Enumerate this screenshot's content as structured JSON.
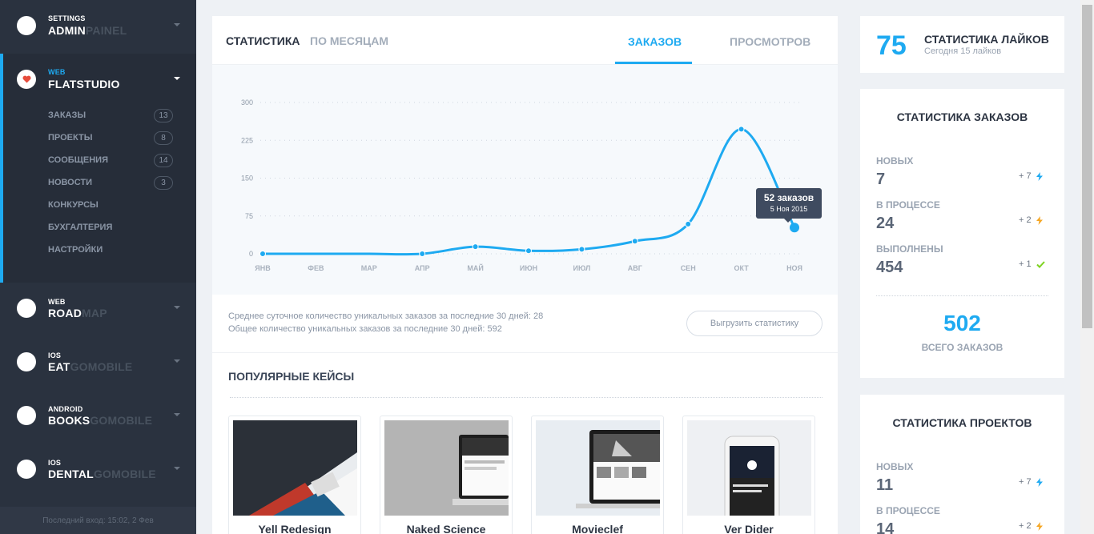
{
  "sidebar": {
    "projects": [
      {
        "prefix": "SETTINGS",
        "name_bold": "ADMIN",
        "name_dim": "PAINEL",
        "icon": "white-circle"
      },
      {
        "prefix": "WEB",
        "name_bold": "FLATSTUDIO",
        "name_dim": "",
        "icon": "heart-icon",
        "active": true
      },
      {
        "prefix": "WEB",
        "name_bold": "ROAD",
        "name_dim": "MAP",
        "icon": "white-circle"
      },
      {
        "prefix": "IOS",
        "name_bold": "EAT",
        "name_dim": "GOMOBILE",
        "icon": "white-circle"
      },
      {
        "prefix": "ANDROID",
        "name_bold": "BOOKS",
        "name_dim": "GOMOBILE",
        "icon": "white-circle"
      },
      {
        "prefix": "IOS",
        "name_bold": "DENTAL",
        "name_dim": "GOMOBILE",
        "icon": "white-circle"
      }
    ],
    "submenu": [
      {
        "label": "ЗАКАЗЫ",
        "count": "13"
      },
      {
        "label": "ПРОЕКТЫ",
        "count": "8"
      },
      {
        "label": "СООБЩЕНИЯ",
        "count": "14"
      },
      {
        "label": "НОВОСТИ",
        "count": "3"
      },
      {
        "label": "КОНКУРСЫ",
        "count": ""
      },
      {
        "label": "БУХГАЛТЕРИЯ",
        "count": ""
      },
      {
        "label": "НАСТРОЙКИ",
        "count": ""
      }
    ],
    "last_login": "Последний вход: 15:02, 2 Фев"
  },
  "main": {
    "tabs_left": [
      "СТАТИСТИКА",
      "ПО МЕСЯЦАМ"
    ],
    "tabs_right": [
      "ЗАКАЗОВ",
      "ПРОСМОТРОВ"
    ],
    "active_right_tab": "ЗАКАЗОВ",
    "tooltip": {
      "title": "52 заказов",
      "date": "5 Ноя 2015"
    },
    "info_line1": "Среднее суточное количество уникальных заказов за последние 30 дней: 28",
    "info_line2": "Общее количество уникальных заказов за последние 30 дней: 592",
    "export_button": "Выгрузить статистику",
    "popular_title": "ПОПУЛЯРНЫЕ КЕЙСЫ",
    "cases": [
      {
        "title": "Yell Redesign"
      },
      {
        "title": "Naked Science"
      },
      {
        "title": "Movieclef"
      },
      {
        "title": "Ver Dider"
      }
    ]
  },
  "chart_data": {
    "type": "line",
    "categories": [
      "ЯНВ",
      "ФЕВ",
      "МАР",
      "АПР",
      "МАЙ",
      "ИЮН",
      "ИЮЛ",
      "АВГ",
      "СЕН",
      "ОКТ",
      "НОЯ"
    ],
    "values": [
      0,
      0,
      0,
      0,
      14,
      6,
      9,
      25,
      59,
      247,
      52
    ],
    "yticks": [
      0,
      75,
      150,
      225,
      300
    ],
    "ylim": [
      0,
      300
    ],
    "grid": true,
    "color": "#1eaaf1"
  },
  "likes": {
    "value": "75",
    "title": "СТАТИСТИКА ЛАЙКОВ",
    "sub": "Сегодня 15 лайков"
  },
  "orders_stats": {
    "title": "СТАТИСТИКА ЗАКАЗОВ",
    "rows": [
      {
        "label": "НОВЫХ",
        "value": "7",
        "delta": "+ 7",
        "icon": "lightning-icon",
        "icon_color": "#1eaaf1"
      },
      {
        "label": "В ПРОЦЕССЕ",
        "value": "24",
        "delta": "+ 2",
        "icon": "lightning-icon",
        "icon_color": "#f5a623"
      },
      {
        "label": "ВЫПОЛНЕНЫ",
        "value": "454",
        "delta": "+ 1",
        "icon": "check-icon",
        "icon_color": "#7ed321"
      }
    ],
    "total": "502",
    "total_label": "ВСЕГО ЗАКАЗОВ"
  },
  "projects_stats": {
    "title": "СТАТИСТИКА ПРОЕКТОВ",
    "rows": [
      {
        "label": "НОВЫХ",
        "value": "11",
        "delta": "+ 7",
        "icon": "lightning-icon",
        "icon_color": "#1eaaf1"
      },
      {
        "label": "В ПРОЦЕССЕ",
        "value": "14",
        "delta": "+ 2",
        "icon": "lightning-icon",
        "icon_color": "#f5a623"
      }
    ]
  }
}
